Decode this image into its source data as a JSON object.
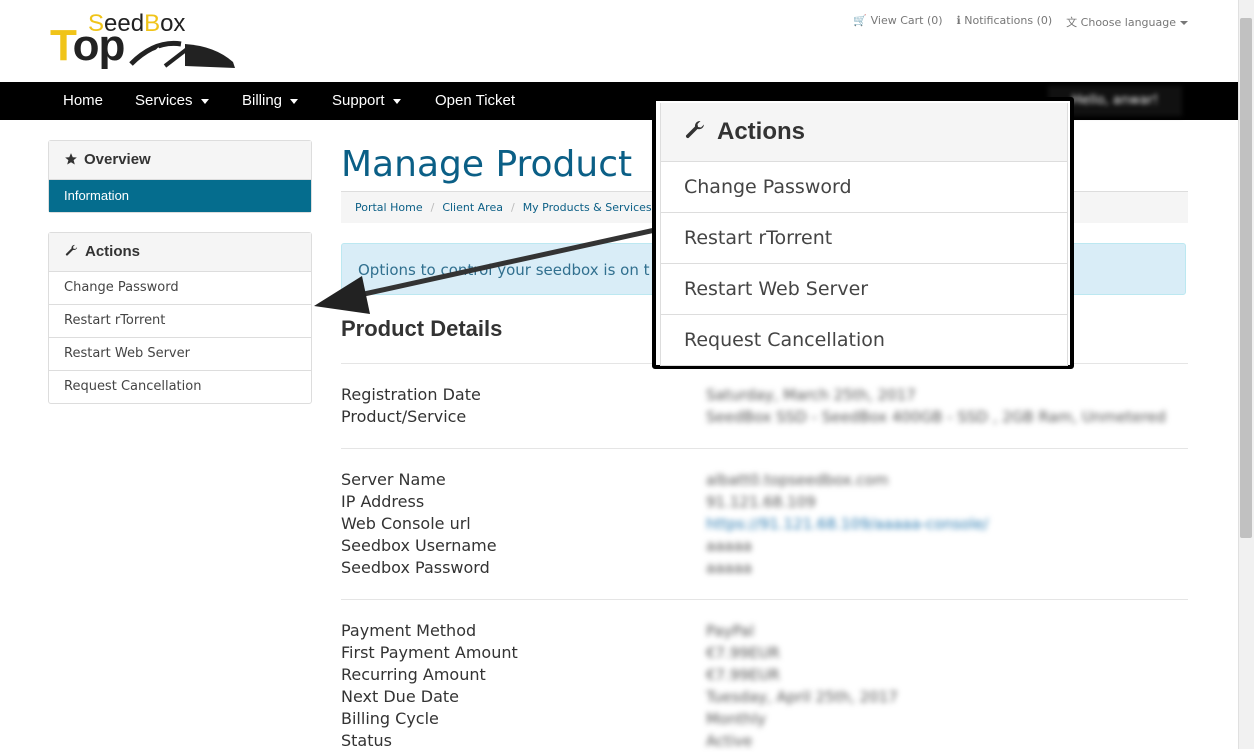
{
  "logo": {
    "top": "Top",
    "seedbox": "SeedBox"
  },
  "topbar": {
    "view_cart": "View Cart (0)",
    "notifications": "Notifications (0)",
    "language": "Choose language"
  },
  "nav": {
    "items": [
      {
        "label": "Home",
        "dropdown": false
      },
      {
        "label": "Services",
        "dropdown": true
      },
      {
        "label": "Billing",
        "dropdown": true
      },
      {
        "label": "Support",
        "dropdown": true
      },
      {
        "label": "Open Ticket",
        "dropdown": false
      }
    ],
    "user": "Hello, anwar!"
  },
  "sidebar": {
    "overview": {
      "title": "Overview",
      "active_item": "Information"
    },
    "actions": {
      "title": "Actions",
      "items": [
        "Change Password",
        "Restart rTorrent",
        "Restart Web Server",
        "Request Cancellation"
      ]
    }
  },
  "main": {
    "title": "Manage Product",
    "breadcrumb": [
      "Portal Home",
      "Client Area",
      "My Products & Services"
    ],
    "alert": "Options to control your seedbox is on t",
    "section_title": "Product Details",
    "groups": [
      [
        {
          "label": "Registration Date",
          "value": "Saturday, March 25th, 2017"
        },
        {
          "label": "Product/Service",
          "value": "SeedBox SSD - SeedBox 400GB - SSD , 2GB Ram, Unmetered"
        }
      ],
      [
        {
          "label": "Server Name",
          "value": "albatt0.topseedbox.com"
        },
        {
          "label": "IP Address",
          "value": "91.121.68.109"
        },
        {
          "label": "Web Console url",
          "value": "https://91.121.68.109/aaaaa-console/",
          "link": true
        },
        {
          "label": "Seedbox Username",
          "value": "aaaaa"
        },
        {
          "label": "Seedbox Password",
          "value": "aaaaa"
        }
      ],
      [
        {
          "label": "Payment Method",
          "value": "PayPal"
        },
        {
          "label": "First Payment Amount",
          "value": "€7.99EUR"
        },
        {
          "label": "Recurring Amount",
          "value": "€7.99EUR"
        },
        {
          "label": "Next Due Date",
          "value": "Tuesday, April 25th, 2017"
        },
        {
          "label": "Billing Cycle",
          "value": "Monthly"
        },
        {
          "label": "Status",
          "value": "Active"
        }
      ]
    ]
  },
  "callout": {
    "title": "Actions",
    "items": [
      "Change Password",
      "Restart rTorrent",
      "Restart Web Server",
      "Request Cancellation"
    ]
  },
  "colors": {
    "accent": "#056d8e",
    "title": "#0b5f86",
    "navbar": "#000000",
    "logo_yellow": "#f0c419"
  }
}
